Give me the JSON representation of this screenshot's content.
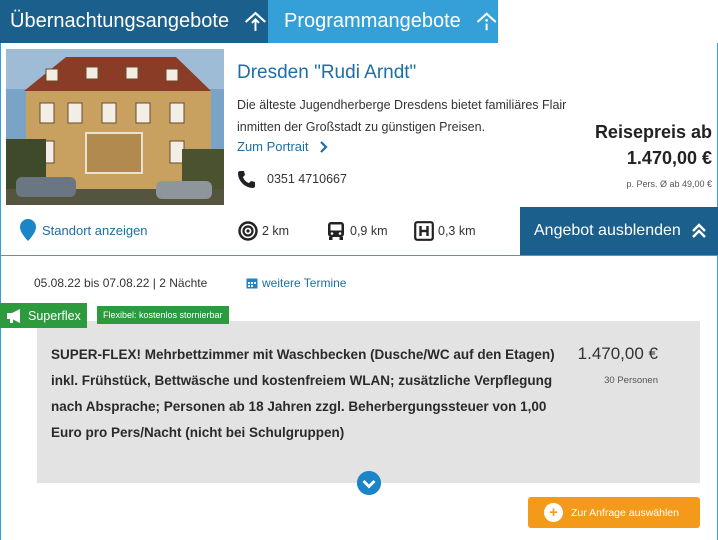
{
  "tabs": [
    {
      "label": "Übernachtungsangebote",
      "icon": "house-arrow-icon",
      "active": true
    },
    {
      "label": "Programmangebote",
      "icon": "house-info-icon",
      "active": false
    }
  ],
  "hostel": {
    "title": "Dresden \"Rudi Arndt\"",
    "description": "Die älteste Jugendherberge Dresdens bietet familiäres Flair inmitten der Großstadt zu günstigen Preisen.",
    "portrait_link": "Zum Portrait",
    "phone": "0351 4710667"
  },
  "price": {
    "label": "Reisepreis ab",
    "value": "1.470,00 €",
    "sub": "p. Pers. Ø ab 49,00 €"
  },
  "info": {
    "location_link": "Standort anzeigen",
    "distances": [
      {
        "icon": "target-icon",
        "value": "2 km"
      },
      {
        "icon": "bus-icon",
        "value": "0,9 km"
      },
      {
        "icon": "stop-h-icon",
        "value": "0,3 km"
      }
    ],
    "hide_button": "Angebot ausblenden"
  },
  "offer": {
    "dates": "05.08.22 bis 07.08.22 | 2 Nächte",
    "more_dates": "weitere Termine",
    "superflex": "Superflex",
    "flexibel": "Flexibel: kostenlos stornierbar",
    "description": "SUPER-FLEX! Mehrbettzimmer mit Waschbecken (Dusche/WC auf den Etagen) inkl. Frühstück, Bettwäsche und kostenfreiem WLAN; zusätzliche Verpflegung nach Absprache; Personen ab 18 Jahren zzgl. Beherbergungssteuer von 1,00 Euro pro Pers/Nacht (nicht bei Schulgruppen)",
    "price": "1.470,00 €",
    "persons": "30 Personen",
    "select_button": "Zur Anfrage auswählen"
  },
  "colors": {
    "primary": "#1b5f8d",
    "accent": "#35a0d8",
    "green": "#2e9a3e",
    "orange": "#f39a1b"
  }
}
